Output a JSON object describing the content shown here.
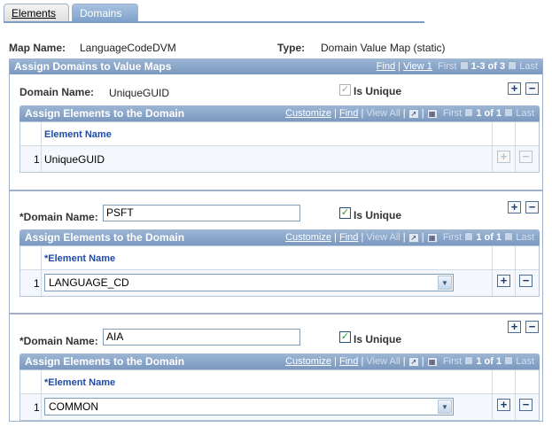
{
  "tabs": [
    {
      "label": "Elements"
    },
    {
      "label": "Domains"
    }
  ],
  "header": {
    "map_name_label": "Map Name:",
    "map_name_value": "LanguageCodeDVM",
    "type_label": "Type:",
    "type_value": "Domain Value Map (static)"
  },
  "assign_domains": {
    "title": "Assign Domains to Value Maps",
    "find": "Find",
    "sep": "|",
    "view": "View 1",
    "first": "First",
    "count": "1-3 of 3",
    "last": "Last"
  },
  "domains": [
    {
      "domain_label": "Domain Name:",
      "domain_value": "UniqueGUID",
      "is_unique_label": "Is Unique",
      "grid_title": "Assign Elements to the Domain",
      "customize": "Customize",
      "find": "Find",
      "view_all": "View All",
      "first": "First",
      "count": "1 of 1",
      "last": "Last",
      "col_header": "Element Name",
      "row_num": "1",
      "element_value": "UniqueGUID"
    },
    {
      "domain_label": "*Domain Name:",
      "domain_value": "PSFT",
      "is_unique_label": "Is Unique",
      "grid_title": "Assign Elements to the Domain",
      "customize": "Customize",
      "find": "Find",
      "view_all": "View All",
      "first": "First",
      "count": "1 of 1",
      "last": "Last",
      "col_header": "*Element Name",
      "row_num": "1",
      "element_value": "LANGUAGE_CD"
    },
    {
      "domain_label": "*Domain Name:",
      "domain_value": "AIA",
      "is_unique_label": "Is Unique",
      "grid_title": "Assign Elements to the Domain",
      "customize": "Customize",
      "find": "Find",
      "view_all": "View All",
      "first": "First",
      "count": "1 of 1",
      "last": "Last",
      "col_header": "*Element Name",
      "row_num": "1",
      "element_value": "COMMON"
    }
  ],
  "icons": {
    "plus": "+",
    "minus": "−",
    "check": "✓",
    "arrow_left": "◀",
    "arrow_right": "▶",
    "dropdown": "▼"
  },
  "colors": {
    "header_bar": "#7a98bf",
    "link": "#1e4ba8",
    "check": "#21a121"
  }
}
